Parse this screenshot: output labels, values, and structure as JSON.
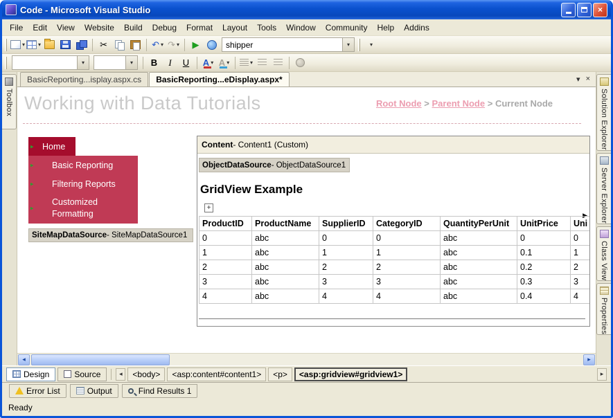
{
  "window": {
    "title": "Code - Microsoft Visual Studio"
  },
  "menu": {
    "items": [
      "File",
      "Edit",
      "View",
      "Website",
      "Build",
      "Debug",
      "Format",
      "Layout",
      "Tools",
      "Window",
      "Community",
      "Help",
      "Addins"
    ]
  },
  "toolbar": {
    "search_combo": "shipper"
  },
  "doc_tabs": [
    {
      "label": "BasicReporting...isplay.aspx.cs",
      "active": false
    },
    {
      "label": "BasicReporting...eDisplay.aspx*",
      "active": true
    }
  ],
  "left_panel": {
    "toolbox": "Toolbox"
  },
  "right_panel": {
    "tabs": [
      "Solution Explorer",
      "Server Explorer",
      "Class View",
      "Properties"
    ]
  },
  "design": {
    "page_title": "Working with Data Tutorials",
    "breadcrumb": {
      "root": "Root Node",
      "sep": ">",
      "parent": "Parent Node",
      "current": "Current Node"
    },
    "nav": {
      "items": [
        "Home",
        "Basic Reporting",
        "Filtering Reports",
        "Customized Formatting"
      ]
    },
    "sitemap": {
      "bold": "SiteMapDataSource",
      "rest": " - SiteMapDataSource1"
    },
    "content": {
      "header_bold": "Content",
      "header_rest": " - Content1 (Custom)",
      "ods_bold": "ObjectDataSource",
      "ods_rest": " - ObjectDataSource1",
      "grid_title": "GridView Example"
    }
  },
  "grid": {
    "columns": [
      "ProductID",
      "ProductName",
      "SupplierID",
      "CategoryID",
      "QuantityPerUnit",
      "UnitPrice",
      "Uni"
    ],
    "rows": [
      [
        "0",
        "abc",
        "0",
        "0",
        "abc",
        "0",
        "0"
      ],
      [
        "1",
        "abc",
        "1",
        "1",
        "abc",
        "0.1",
        "1"
      ],
      [
        "2",
        "abc",
        "2",
        "2",
        "abc",
        "0.2",
        "2"
      ],
      [
        "3",
        "abc",
        "3",
        "3",
        "abc",
        "0.3",
        "3"
      ],
      [
        "4",
        "abc",
        "4",
        "4",
        "abc",
        "0.4",
        "4"
      ]
    ]
  },
  "bottom": {
    "design_label": "Design",
    "source_label": "Source",
    "tags": [
      "<body>",
      "<asp:content#content1>",
      "<p>",
      "<asp:gridview#gridview1>"
    ],
    "panel_tabs": [
      "Error List",
      "Output",
      "Find Results 1"
    ],
    "status": "Ready"
  },
  "icons": {
    "dropdown": "▾",
    "close": "×",
    "cut": "✂",
    "undo": "↶",
    "redo": "↷",
    "play": "▶",
    "nav_arrow": "▸",
    "smart_plus": "+",
    "smart_arrow": "▶",
    "scroll_left": "◂",
    "scroll_right": "▸",
    "bold": "B",
    "italic": "I",
    "underline": "U",
    "font_color": "A",
    "highlight": "A"
  },
  "colors": {
    "titlebar_blue": "#0A51CE",
    "nav_dark": "#A50D2D",
    "nav_light": "#C03A55",
    "link_pink": "#EC9DB0",
    "heading_gray": "#C9C9C9"
  }
}
